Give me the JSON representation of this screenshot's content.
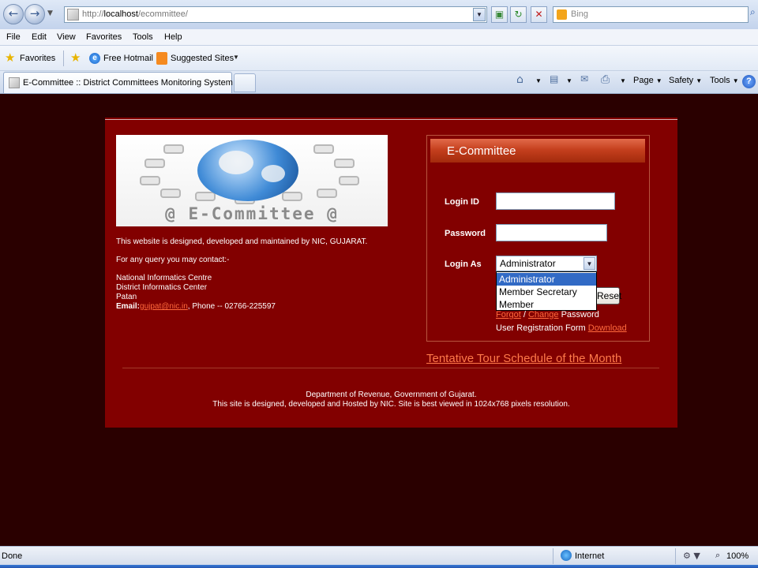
{
  "browser": {
    "url_prefix": "http://",
    "url_host": "localhost",
    "url_path": "/ecommittee/",
    "search_placeholder": "Bing",
    "menu": [
      "File",
      "Edit",
      "View",
      "Favorites",
      "Tools",
      "Help"
    ],
    "favorites_label": "Favorites",
    "fav_links": [
      "Free Hotmail",
      "Suggested Sites"
    ],
    "tab_title": "E-Committee :: District Committees Monitoring System",
    "commands": [
      "Page",
      "Safety",
      "Tools"
    ]
  },
  "page": {
    "logo_text": "@ E-Committee @",
    "info": {
      "designed_by": "This website is designed, developed and maintained by NIC, GUJARAT.",
      "query": "For any query you may contact:-",
      "address1": "National Informatics Centre",
      "address2": "District Informatics Center",
      "address3": "Patan",
      "email_label": "Email:",
      "email": "gujpat@nic.in",
      "phone": ", Phone -- 02766-225597"
    },
    "login": {
      "title": "E-Committee",
      "loginid_label": "Login ID",
      "password_label": "Password",
      "loginas_label": "Login As",
      "loginas_value": "Administrator",
      "options": [
        "Administrator",
        "Member Secretary",
        "Member"
      ],
      "reset_label": "Reset",
      "forgot_link": "Forgot",
      "slash": " / ",
      "change_link": "Change",
      "password_word": " Password",
      "registration_text": "User Registration Form ",
      "download_link": "Download"
    },
    "tour_link": "Tentative Tour Schedule of the Month",
    "footer1": "Department of Revenue, Government of Gujarat.",
    "footer2": "This site is designed, developed and Hosted by NIC. Site is best viewed in 1024x768 pixels resolution."
  },
  "status": {
    "text": "Done",
    "zone": "Internet",
    "zoom": "100%"
  },
  "colors": {
    "page_background": "#2a0000",
    "container": "#820000",
    "header_orange": "#c5401e",
    "link": "#ff6a3d"
  }
}
